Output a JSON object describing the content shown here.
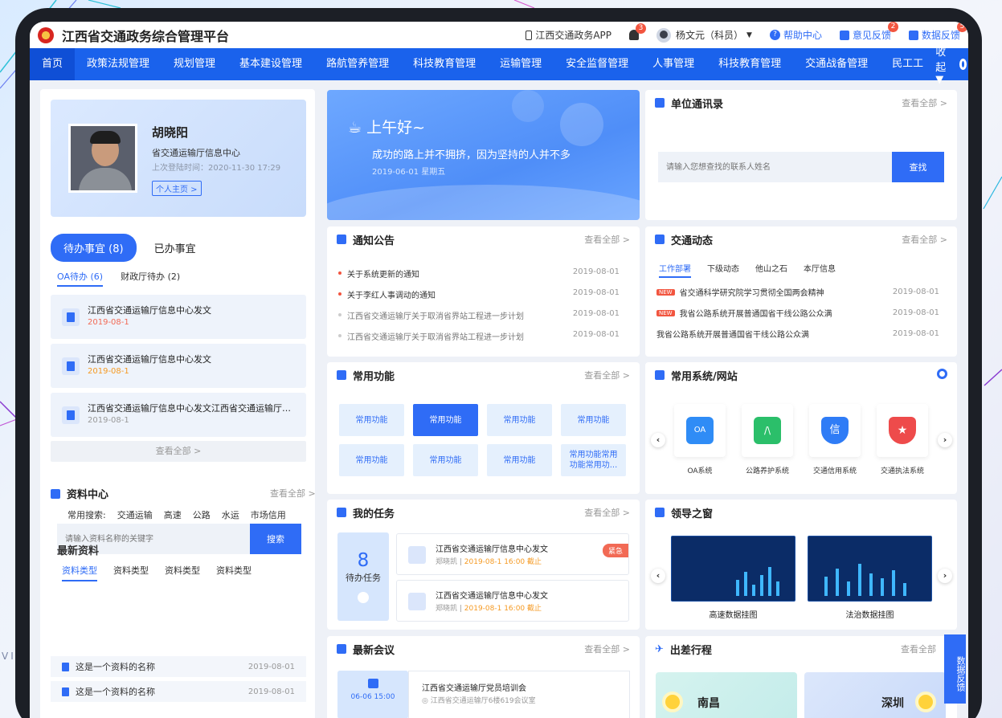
{
  "topbar": {
    "title": "江西省交通政务综合管理平台",
    "app": "江西交通政务APP",
    "notify_count": "3",
    "user": "杨文元（科员）",
    "help": "帮助中心",
    "feedback": "意见反馈",
    "feedback_count": "2",
    "data_feedback": "数据反馈",
    "data_feedback_count": "5"
  },
  "nav": {
    "items": [
      "首页",
      "政策法规管理",
      "规划管理",
      "基本建设管理",
      "路航管养管理",
      "科技教育管理",
      "运输管理",
      "安全监督管理",
      "人事管理",
      "科技教育管理",
      "交通战备管理",
      "民工工"
    ],
    "collapse": "收起"
  },
  "profile": {
    "name": "胡晓阳",
    "org": "省交通运输厅信息中心",
    "last_login": "上次登陆时间：2020-11-30  17:29",
    "home_link": "个人主页 >"
  },
  "todo": {
    "tab_pending": "待办事宜 (8)",
    "tab_done": "已办事宜",
    "sub_oa": "OA待办 (6)",
    "sub_finance": "财政厅待办 (2)",
    "items": [
      {
        "title": "江西省交通运输厅信息中心发文",
        "date": "2019-08-1",
        "color": "#f26a55"
      },
      {
        "title": "江西省交通运输厅信息中心发文",
        "date": "2019-08-1",
        "color": "#f59a23"
      },
      {
        "title": "江西省交通运输厅信息中心发文江西省交通运输厅信息中...",
        "date": "2019-08-1",
        "color": "#999999"
      }
    ],
    "view_all": "查看全部 >"
  },
  "materials": {
    "title": "资料中心",
    "more": "查看全部 >",
    "placeholder": "请输入资料名称的关键字",
    "search": "搜索",
    "common_label": "常用搜索:",
    "common": [
      "交通运输",
      "高速",
      "公路",
      "水运",
      "市场信用"
    ],
    "latest": "最新资料",
    "types": [
      "资料类型",
      "资料类型",
      "资料类型",
      "资料类型"
    ],
    "files": [
      {
        "name": "这是一个资料的名称",
        "date": "2019-08-01"
      },
      {
        "name": "这是一个资料的名称",
        "date": "2019-08-01"
      }
    ]
  },
  "greeting": {
    "hello": "上午好~",
    "motto": "成功的路上并不拥挤，因为坚持的人并不多",
    "date": "2019-06-01  星期五"
  },
  "notices": {
    "title": "通知公告",
    "more": "查看全部 >",
    "items": [
      {
        "text": "关于系统更新的通知",
        "date": "2019-08-01",
        "dot": "#f2553f"
      },
      {
        "text": "关于李红人事调动的通知",
        "date": "2019-08-01",
        "dot": "#f2553f"
      },
      {
        "text": "江西省交通运输厅关于取消省界站工程进一步计划",
        "date": "2019-08-01",
        "dot": "#cccccc"
      },
      {
        "text": "江西省交通运输厅关于取消省界站工程进一步计划",
        "date": "2019-08-01",
        "dot": "#cccccc"
      }
    ]
  },
  "functions": {
    "title": "常用功能",
    "more": "查看全部 >",
    "items": [
      "常用功能",
      "常用功能",
      "常用功能",
      "常用功能",
      "常用功能",
      "常用功能",
      "常用功能",
      "常用功能常用功能常用功..."
    ]
  },
  "tasks": {
    "title": "我的任务",
    "more": "查看全部 >",
    "count": "8",
    "label": "待办任务",
    "items": [
      {
        "title": "江西省交通运输厅信息中心发文",
        "person": "郑晓凯 | ",
        "deadline": "2019-08-1 16:00  截止",
        "tag": "紧急"
      },
      {
        "title": "江西省交通运输厅信息中心发文",
        "person": "郑晓凯 | ",
        "deadline": "2019-08-1 16:00  截止",
        "tag": ""
      }
    ]
  },
  "meetings": {
    "title": "最新会议",
    "more": "查看全部 >",
    "date": "06-06 15:00",
    "name": "江西省交通运输厅党员培训会",
    "location": "◎ 江西省交通运输厅6楼619会议室"
  },
  "contacts": {
    "title": "单位通讯录",
    "more": "查看全部 >",
    "placeholder": "请输入您想查找的联系人姓名",
    "search": "查找"
  },
  "dynamics": {
    "title": "交通动态",
    "more": "查看全部 >",
    "tabs": [
      "工作部署",
      "下级动态",
      "他山之石",
      "本厅信息"
    ],
    "items": [
      {
        "text": "省交通科学研究院学习贯彻全国两会精神",
        "date": "2019-08-01",
        "new": "NEW"
      },
      {
        "text": "我省公路系统开展普通国省干线公路公众满",
        "date": "2019-08-01",
        "new": "NEW"
      },
      {
        "text": "我省公路系统开展普通国省干线公路公众满",
        "date": "2019-08-01",
        "new": ""
      }
    ]
  },
  "systems": {
    "title": "常用系统/网站",
    "items": [
      {
        "name": "OA系统",
        "color": "#2f8cf6",
        "glyph": "OA"
      },
      {
        "name": "公路养护系统",
        "color": "#2bbf6a",
        "glyph": "/\\"
      },
      {
        "name": "交通信用系统",
        "color": "#2f7cf6",
        "glyph": "信"
      },
      {
        "name": "交通执法系统",
        "color": "#ee4b4b",
        "glyph": "★"
      }
    ]
  },
  "leaders": {
    "title": "领导之窗",
    "items": [
      "高速数据挂图",
      "法治数据挂图"
    ]
  },
  "trips": {
    "title": "出差行程",
    "more": "查看全部",
    "cities": [
      "南昌",
      "深圳"
    ]
  },
  "side_feedback": "数据反馈",
  "watermark": "VI"
}
